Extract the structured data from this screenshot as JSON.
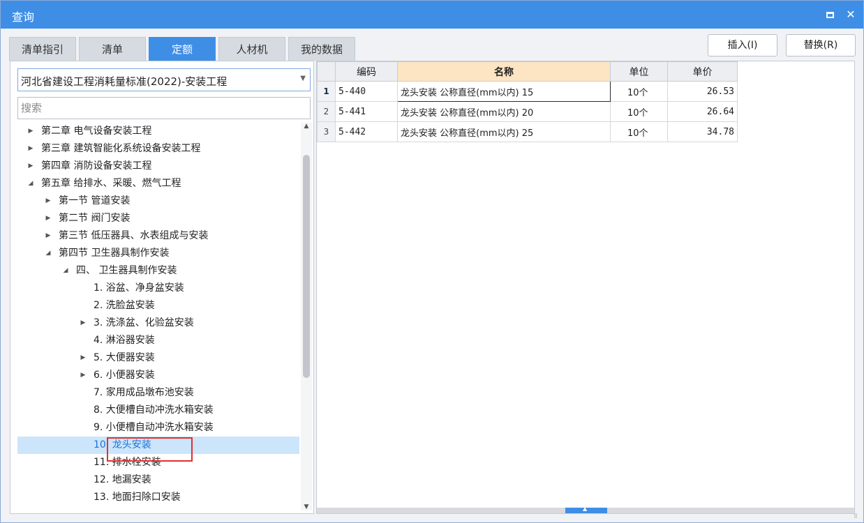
{
  "window": {
    "title": "查询"
  },
  "tabs": [
    {
      "label": "清单指引"
    },
    {
      "label": "清单"
    },
    {
      "label": "定额"
    },
    {
      "label": "人材机"
    },
    {
      "label": "我的数据"
    }
  ],
  "actions": {
    "insert_label": "插入(I)",
    "replace_label": "替换(R)"
  },
  "left": {
    "library": "河北省建设工程消耗量标准(2022)-安装工程",
    "search_placeholder": "搜索",
    "tree": [
      {
        "label": "第二章 电气设备安装工程",
        "expander": "collapsed",
        "level": 0
      },
      {
        "label": "第三章 建筑智能化系统设备安装工程",
        "expander": "collapsed",
        "level": 0
      },
      {
        "label": "第四章 消防设备安装工程",
        "expander": "collapsed",
        "level": 0
      },
      {
        "label": "第五章 给排水、采暖、燃气工程",
        "expander": "expanded",
        "level": 0
      },
      {
        "label": "第一节 管道安装",
        "expander": "collapsed",
        "level": 1
      },
      {
        "label": "第二节 阀门安装",
        "expander": "collapsed",
        "level": 1
      },
      {
        "label": "第三节 低压器具、水表组成与安装",
        "expander": "collapsed",
        "level": 1
      },
      {
        "label": "第四节 卫生器具制作安装",
        "expander": "expanded",
        "level": 1
      },
      {
        "label": "四、 卫生器具制作安装",
        "expander": "expanded",
        "level": 2
      },
      {
        "label": "1. 浴盆、净身盆安装",
        "expander": "none",
        "level": 3
      },
      {
        "label": "2. 洗脸盆安装",
        "expander": "none",
        "level": 3
      },
      {
        "label": "3. 洗涤盆、化验盆安装",
        "expander": "collapsed",
        "level": 3
      },
      {
        "label": "4. 淋浴器安装",
        "expander": "none",
        "level": 3
      },
      {
        "label": "5. 大便器安装",
        "expander": "collapsed",
        "level": 3
      },
      {
        "label": "6. 小便器安装",
        "expander": "collapsed",
        "level": 3
      },
      {
        "label": "7. 家用成品墩布池安装",
        "expander": "none",
        "level": 3
      },
      {
        "label": "8. 大便槽自动冲洗水箱安装",
        "expander": "none",
        "level": 3
      },
      {
        "label": "9. 小便槽自动冲洗水箱安装",
        "expander": "none",
        "level": 3
      },
      {
        "label": "10. 龙头安装",
        "expander": "none",
        "level": 3,
        "selected": true
      },
      {
        "label": "11. 排水栓安装",
        "expander": "none",
        "level": 3
      },
      {
        "label": "12. 地漏安装",
        "expander": "none",
        "level": 3
      },
      {
        "label": "13. 地面扫除口安装",
        "expander": "none",
        "level": 3
      }
    ]
  },
  "grid": {
    "columns": [
      "编码",
      "名称",
      "单位",
      "单价"
    ],
    "rows": [
      {
        "num": "1",
        "code": "5-440",
        "name": "龙头安装 公称直径(mm以内) 15",
        "unit": "10个",
        "price": "26.53"
      },
      {
        "num": "2",
        "code": "5-441",
        "name": "龙头安装 公称直径(mm以内) 20",
        "unit": "10个",
        "price": "26.64"
      },
      {
        "num": "3",
        "code": "5-442",
        "name": "龙头安装 公称直径(mm以内) 25",
        "unit": "10个",
        "price": "34.78"
      }
    ]
  },
  "colors": {
    "accent": "#3f8ee6",
    "selection": "#cce5fb",
    "highlight": "#e0302e",
    "name_header": "#fde4c2"
  }
}
